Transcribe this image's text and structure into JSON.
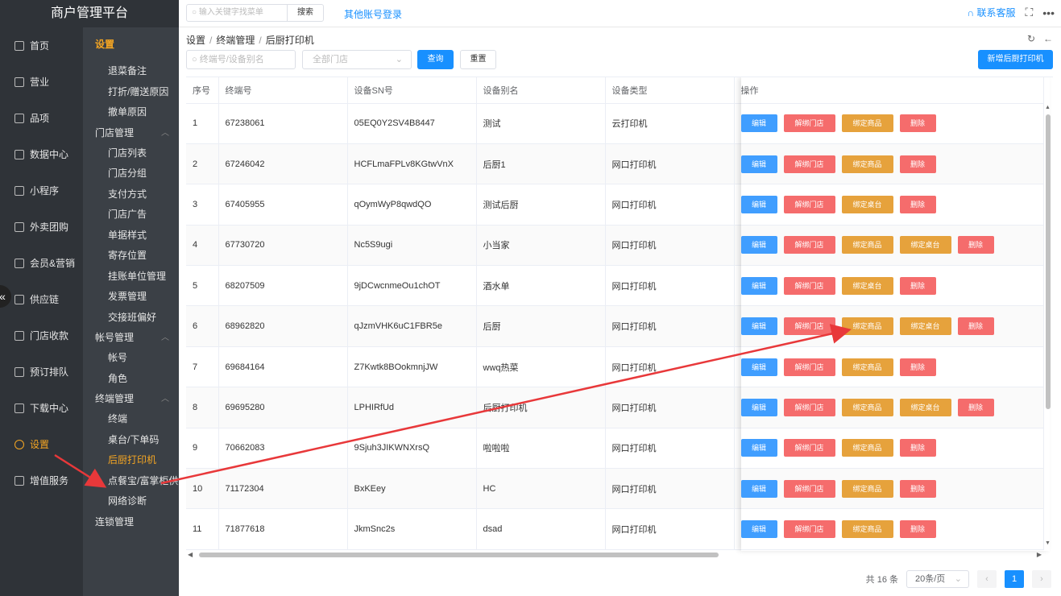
{
  "app": {
    "title": "商户管理平台"
  },
  "topbar": {
    "search_placeholder": "输入关键字找菜单",
    "search_button": "搜索",
    "other_login": "其他账号登录",
    "support": "联系客服"
  },
  "nav": {
    "items": [
      {
        "label": "首页",
        "icon": "home-icon"
      },
      {
        "label": "营业",
        "icon": "calendar-icon"
      },
      {
        "label": "品项",
        "icon": "bag-icon"
      },
      {
        "label": "数据中心",
        "icon": "share-icon"
      },
      {
        "label": "小程序",
        "icon": "phone-icon"
      },
      {
        "label": "外卖团购",
        "icon": "bike-icon"
      },
      {
        "label": "会员&营销",
        "icon": "user-icon"
      },
      {
        "label": "供应链",
        "icon": "truck-icon"
      },
      {
        "label": "门店收款",
        "icon": "coins-icon"
      },
      {
        "label": "预订排队",
        "icon": "clock-icon"
      },
      {
        "label": "下载中心",
        "icon": "download-icon"
      },
      {
        "label": "设置",
        "icon": "gear-icon"
      },
      {
        "label": "增值服务",
        "icon": "service-icon"
      }
    ],
    "active_index": 11
  },
  "submenu": {
    "title": "设置",
    "top_items": [
      "退菜备注",
      "打折/赠送原因",
      "撤单原因"
    ],
    "groups": [
      {
        "label": "门店管理",
        "items": [
          "门店列表",
          "门店分组",
          "支付方式",
          "门店广告",
          "单据样式",
          "寄存位置",
          "挂账单位管理",
          "发票管理",
          "交接班偏好"
        ]
      },
      {
        "label": "帐号管理",
        "items": [
          "帐号",
          "角色"
        ]
      },
      {
        "label": "终端管理",
        "items": [
          "终端",
          "桌台/下单码",
          "后厨打印机",
          "点餐宝/富掌柜供应",
          "网络诊断"
        ]
      }
    ],
    "tail_item": "连锁管理",
    "active_item": "后厨打印机"
  },
  "breadcrumb": [
    "设置",
    "终端管理",
    "后厨打印机"
  ],
  "filters": {
    "terminal_placeholder": "终端号/设备别名",
    "store_placeholder": "全部门店",
    "query_button": "查询",
    "reset_button": "重置",
    "new_button": "新增后厨打印机"
  },
  "table": {
    "headers": [
      "序号",
      "终端号",
      "设备SN号",
      "设备别名",
      "设备类型",
      "操作"
    ],
    "rows": [
      {
        "no": "1",
        "terminal": "67238061",
        "sn": "05EQ0Y2SV4B8447",
        "alias": "测试",
        "type": "云打印机",
        "ops": [
          "编辑",
          "解绑门店",
          "绑定商品",
          "删除"
        ]
      },
      {
        "no": "2",
        "terminal": "67246042",
        "sn": "HCFLmaFPLv8KGtwVnX",
        "alias": "后厨1",
        "type": "网口打印机",
        "ops": [
          "编辑",
          "解绑门店",
          "绑定商品",
          "删除"
        ]
      },
      {
        "no": "3",
        "terminal": "67405955",
        "sn": "qOymWyP8qwdQO",
        "alias": "测试后厨",
        "type": "网口打印机",
        "ops": [
          "编辑",
          "解绑门店",
          "绑定桌台",
          "删除"
        ]
      },
      {
        "no": "4",
        "terminal": "67730720",
        "sn": "Nc5S9ugi",
        "alias": "小当家",
        "type": "网口打印机",
        "ops": [
          "编辑",
          "解绑门店",
          "绑定商品",
          "绑定桌台",
          "删除"
        ]
      },
      {
        "no": "5",
        "terminal": "68207509",
        "sn": "9jDCwcnmeOu1chOT",
        "alias": "酒水单",
        "type": "网口打印机",
        "ops": [
          "编辑",
          "解绑门店",
          "绑定桌台",
          "删除"
        ]
      },
      {
        "no": "6",
        "terminal": "68962820",
        "sn": "qJzmVHK6uC1FBR5e",
        "alias": "后厨",
        "type": "网口打印机",
        "ops": [
          "编辑",
          "解绑门店",
          "绑定商品",
          "绑定桌台",
          "删除"
        ]
      },
      {
        "no": "7",
        "terminal": "69684164",
        "sn": "Z7Kwtk8BOokmnjJW",
        "alias": "wwq热菜",
        "type": "网口打印机",
        "ops": [
          "编辑",
          "解绑门店",
          "绑定商品",
          "删除"
        ]
      },
      {
        "no": "8",
        "terminal": "69695280",
        "sn": "LPHIRfUd",
        "alias": "后厨打印机",
        "type": "网口打印机",
        "ops": [
          "编辑",
          "解绑门店",
          "绑定商品",
          "绑定桌台",
          "删除"
        ]
      },
      {
        "no": "9",
        "terminal": "70662083",
        "sn": "9Sjuh3JIKWNXrsQ",
        "alias": "啦啦啦",
        "type": "网口打印机",
        "ops": [
          "编辑",
          "解绑门店",
          "绑定商品",
          "删除"
        ]
      },
      {
        "no": "10",
        "terminal": "71172304",
        "sn": "BxKEey",
        "alias": "HC",
        "type": "网口打印机",
        "ops": [
          "编辑",
          "解绑门店",
          "绑定商品",
          "删除"
        ]
      },
      {
        "no": "11",
        "terminal": "71877618",
        "sn": "JkmSnc2s",
        "alias": "dsad",
        "type": "网口打印机",
        "ops": [
          "编辑",
          "解绑门店",
          "绑定商品",
          "删除"
        ]
      }
    ]
  },
  "pager": {
    "total": "共 16 条",
    "page_size": "20条/页",
    "current": "1"
  },
  "colors": {
    "accent": "#1890ff",
    "active_menu": "#f5a623",
    "annotation": "#e8383a"
  }
}
